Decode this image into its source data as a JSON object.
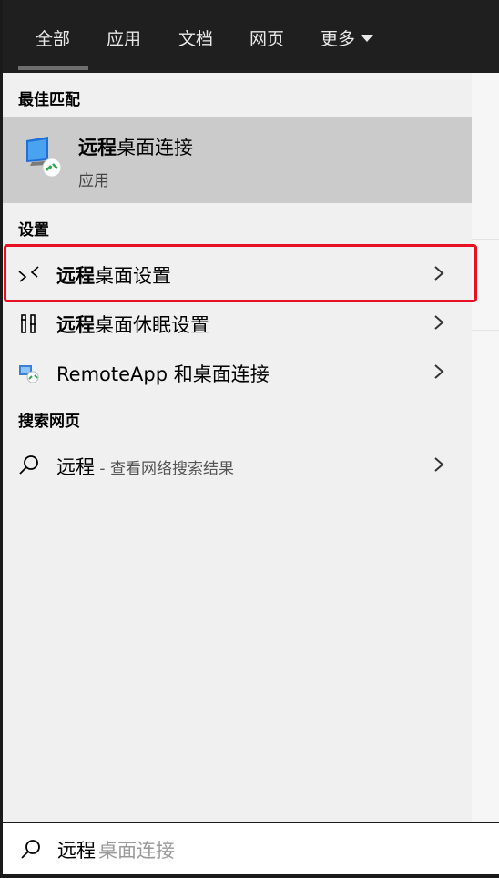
{
  "tabs": [
    {
      "label": "全部",
      "active": true
    },
    {
      "label": "应用"
    },
    {
      "label": "文档"
    },
    {
      "label": "网页"
    },
    {
      "label": "更多"
    }
  ],
  "best_match": {
    "header": "最佳匹配",
    "title_bold": "远程",
    "title_rest": "桌面连接",
    "subtitle": "应用",
    "icon": "remote-desktop-icon"
  },
  "settings": {
    "header": "设置",
    "items": [
      {
        "bold": "远程",
        "rest": "桌面设置",
        "icon": "remote-settings-icon",
        "highlighted": true
      },
      {
        "bold": "远程",
        "rest": "桌面休眠设置",
        "icon": "power-settings-icon"
      },
      {
        "bold": "",
        "rest": "RemoteApp 和桌面连接",
        "icon": "remoteapp-icon"
      }
    ]
  },
  "web": {
    "header": "搜索网页",
    "item": {
      "query": "远程",
      "suffix": " - 查看网络搜索结果",
      "icon": "search-icon"
    }
  },
  "search": {
    "typed": "远程",
    "suggestion": "桌面连接"
  },
  "colors": {
    "highlight": "#e81123",
    "selected_bg": "#cbcbcb",
    "topbar": "#1f1f1f"
  }
}
